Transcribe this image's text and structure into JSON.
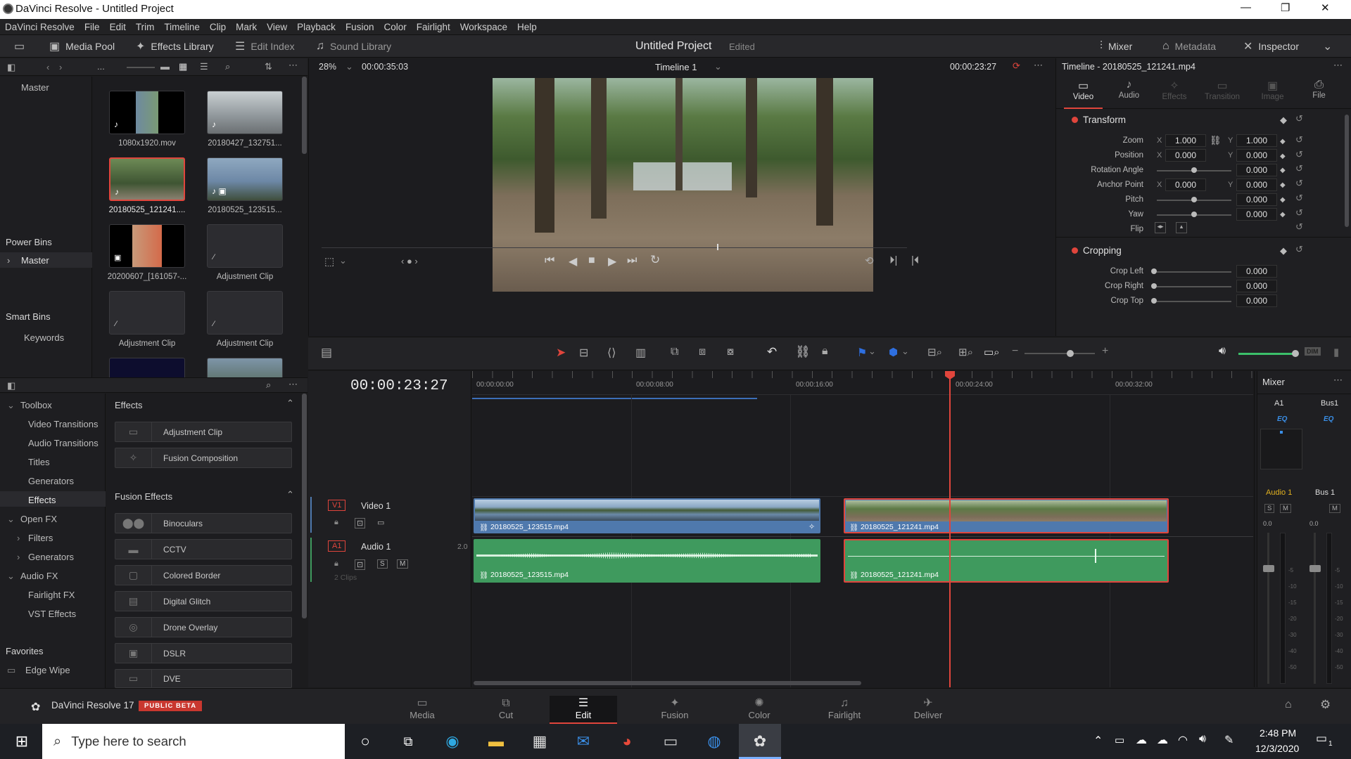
{
  "window": {
    "title": "DaVinci Resolve - Untitled Project",
    "min": "—",
    "max": "❐",
    "close": "✕"
  },
  "menu": [
    "DaVinci Resolve",
    "File",
    "Edit",
    "Trim",
    "Timeline",
    "Clip",
    "Mark",
    "View",
    "Playback",
    "Fusion",
    "Color",
    "Fairlight",
    "Workspace",
    "Help"
  ],
  "toolbar": {
    "media_pool": "Media Pool",
    "effects_library": "Effects Library",
    "edit_index": "Edit Index",
    "sound_library": "Sound Library",
    "project_title": "Untitled Project",
    "project_status": "Edited",
    "mixer": "Mixer",
    "metadata": "Metadata",
    "inspector": "Inspector"
  },
  "media_pool": {
    "bin_root": "Master",
    "power_bins": "Power Bins",
    "power_bins_master": "Master",
    "smart_bins": "Smart Bins",
    "keywords": "Keywords",
    "ellipsis": "...",
    "clips": [
      {
        "label": "1080x1920.mov"
      },
      {
        "label": "20180427_132751..."
      },
      {
        "label": "20180525_121241...."
      },
      {
        "label": "20180525_123515..."
      },
      {
        "label": "20200607_[161057-..."
      },
      {
        "label": "Adjustment Clip"
      },
      {
        "label": "Adjustment Clip"
      },
      {
        "label": "Adjustment Clip"
      }
    ]
  },
  "effects": {
    "toolbox": "Toolbox",
    "video_transitions": "Video Transitions",
    "audio_transitions": "Audio Transitions",
    "titles": "Titles",
    "generators": "Generators",
    "effects": "Effects",
    "open_fx": "Open FX",
    "filters": "Filters",
    "openfx_generators": "Generators",
    "audio_fx": "Audio FX",
    "fairlight_fx": "Fairlight FX",
    "vst_effects": "VST Effects",
    "favorites": "Favorites",
    "edge_wipe": "Edge Wipe",
    "section_effects": "Effects",
    "effects_items": [
      "Adjustment Clip",
      "Fusion Composition"
    ],
    "section_fusion": "Fusion Effects",
    "fusion_items": [
      "Binoculars",
      "CCTV",
      "Colored Border",
      "Digital Glitch",
      "Drone Overlay",
      "DSLR",
      "DVE"
    ]
  },
  "viewer": {
    "zoom": "28%",
    "duration": "00:00:35:03",
    "timeline_name": "Timeline 1",
    "timecode": "00:00:23:27"
  },
  "timeline": {
    "timecode": "00:00:23:27",
    "ruler": [
      "00:00:00:00",
      "00:00:08:00",
      "00:00:16:00",
      "00:00:24:00",
      "00:00:32:00"
    ],
    "video_track": {
      "id": "V1",
      "name": "Video 1"
    },
    "audio_track": {
      "id": "A1",
      "name": "Audio 1",
      "channels": "2.0",
      "clips_count": "2 Clips",
      "solo": "S",
      "mute": "M"
    },
    "clips": {
      "v1_a": "20180525_123515.mp4",
      "v1_b": "20180525_121241.mp4",
      "a1_a": "20180525_123515.mp4",
      "a1_b": "20180525_121241.mp4"
    },
    "zoom_dim": "DIM"
  },
  "inspector": {
    "title": "Timeline - 20180525_121241.mp4",
    "tabs": [
      "Video",
      "Audio",
      "Effects",
      "Transition",
      "Image",
      "File"
    ],
    "transform": "Transform",
    "zoom_label": "Zoom",
    "zoom_x": "1.000",
    "zoom_y": "1.000",
    "position_label": "Position",
    "position_x": "0.000",
    "position_y": "0.000",
    "rotation_label": "Rotation Angle",
    "rotation": "0.000",
    "anchor_label": "Anchor Point",
    "anchor_x": "0.000",
    "anchor_y": "0.000",
    "pitch_label": "Pitch",
    "pitch": "0.000",
    "yaw_label": "Yaw",
    "yaw": "0.000",
    "flip_label": "Flip",
    "x": "X",
    "y": "Y",
    "cropping": "Cropping",
    "crop_left_label": "Crop Left",
    "crop_left": "0.000",
    "crop_right_label": "Crop Right",
    "crop_right": "0.000",
    "crop_top_label": "Crop Top",
    "crop_top": "0.000"
  },
  "mixer": {
    "title": "Mixer",
    "ch1": "A1",
    "ch2": "Bus1",
    "eq": "EQ",
    "strip1": "Audio 1",
    "strip2": "Bus 1",
    "s": "S",
    "m": "M",
    "level": "0.0",
    "scale": [
      "-5",
      "-10",
      "-15",
      "-20",
      "-30",
      "-40",
      "-50"
    ]
  },
  "pages": [
    "Media",
    "Cut",
    "Edit",
    "Fusion",
    "Color",
    "Fairlight",
    "Deliver"
  ],
  "footer": {
    "app": "DaVinci Resolve 17",
    "badge": "PUBLIC BETA"
  },
  "taskbar": {
    "search_placeholder": "Type here to search",
    "time": "2:48 PM",
    "date": "12/3/2020",
    "notif": "1"
  },
  "colors": {
    "accent_red": "#e0453c",
    "video_clip": "#4f79ad",
    "audio_clip": "#3f9a5e",
    "playhead": "#e0453c"
  }
}
